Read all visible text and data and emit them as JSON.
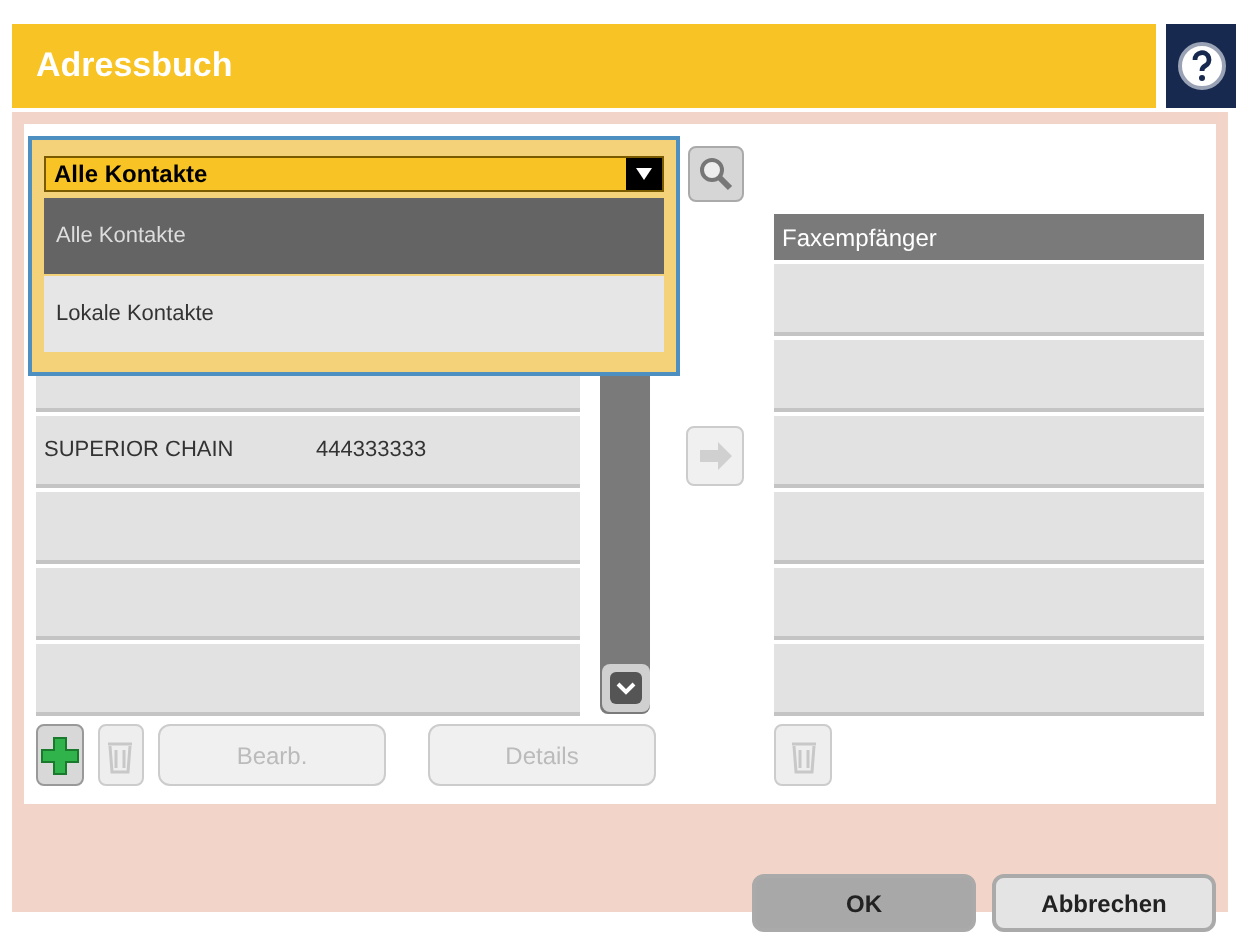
{
  "window": {
    "title": "Adressbuch"
  },
  "contact_source": {
    "value": "Alle Kontakte",
    "expanded": true,
    "options": [
      {
        "label": "Alle Kontakte",
        "selected": true
      },
      {
        "label": "Lokale Kontakte",
        "selected": false
      }
    ]
  },
  "contacts": [
    {
      "name": "SUPERIOR CHAIN",
      "number": "444333333"
    }
  ],
  "recipients": {
    "header": "Faxempfänger"
  },
  "list_buttons": [
    {
      "label": "Bearb.",
      "disabled": true
    },
    {
      "label": "Details",
      "disabled": true
    }
  ],
  "dialog_buttons": [
    {
      "label": "OK",
      "selected": true
    },
    {
      "label": "Abbrechen",
      "selected": false
    }
  ]
}
